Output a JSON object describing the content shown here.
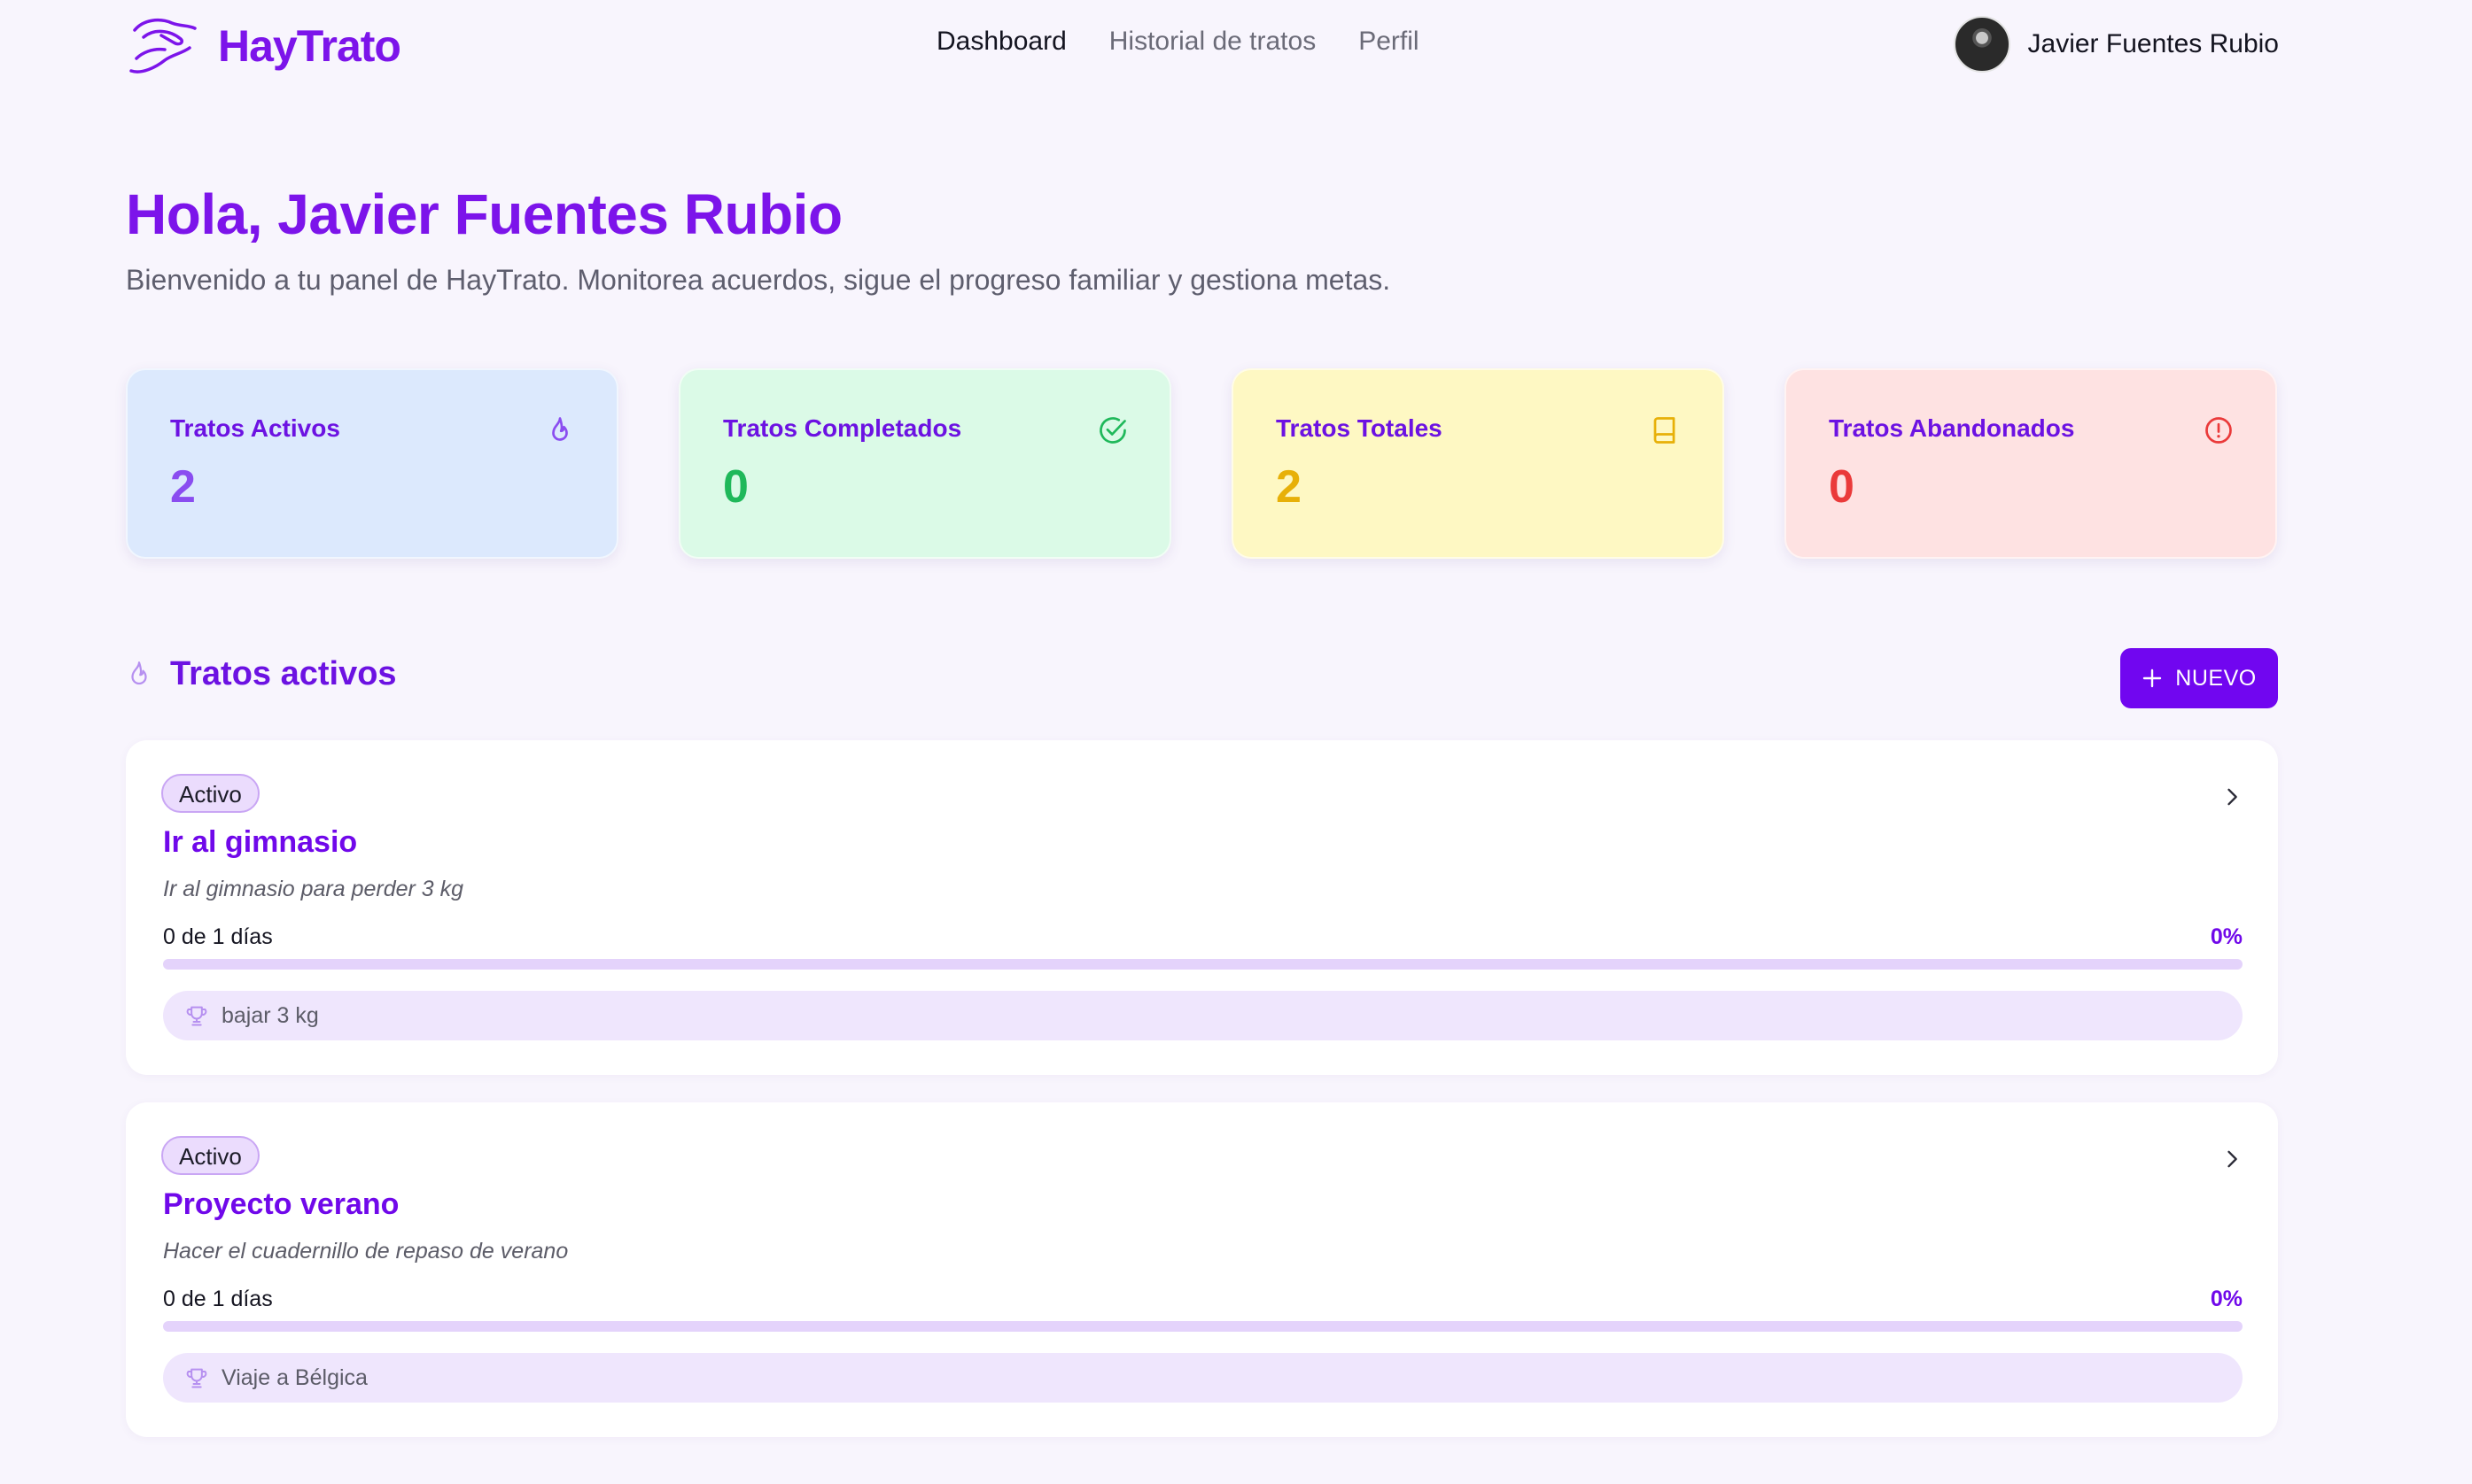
{
  "brand": {
    "name": "HayTrato",
    "accent": "#7106f0"
  },
  "nav": [
    {
      "label": "Dashboard",
      "active": true
    },
    {
      "label": "Historial de tratos",
      "active": false
    },
    {
      "label": "Perfil",
      "active": false
    }
  ],
  "user": {
    "name": "Javier Fuentes Rubio"
  },
  "greeting": {
    "title": "Hola, Javier Fuentes Rubio",
    "subtitle": "Bienvenido a tu panel de HayTrato. Monitorea acuerdos, sigue el progreso familiar y gestiona metas."
  },
  "stats": [
    {
      "label": "Tratos Activos",
      "value": "2",
      "icon": "flame-icon",
      "bg": "#dce9fd",
      "color": "#8a4df0"
    },
    {
      "label": "Tratos Completados",
      "value": "0",
      "icon": "check-circle-icon",
      "bg": "#dbfae7",
      "color": "#1fb85a"
    },
    {
      "label": "Tratos Totales",
      "value": "2",
      "icon": "book-icon",
      "bg": "#fef8c3",
      "color": "#e7b008"
    },
    {
      "label": "Tratos Abandonados",
      "value": "0",
      "icon": "alert-circle-icon",
      "bg": "#fee2e2",
      "color": "#ea3a3a"
    }
  ],
  "section": {
    "title": "Tratos activos",
    "new_button": "NUEVO"
  },
  "deals": [
    {
      "status": "Activo",
      "title": "Ir al gimnasio",
      "description": "Ir al gimnasio para perder 3 kg",
      "progress_text": "0 de 1 días",
      "percent_label": "0%",
      "progress": 0,
      "goal": "bajar 3 kg"
    },
    {
      "status": "Activo",
      "title": "Proyecto verano",
      "description": "Hacer el cuadernillo de repaso de verano",
      "progress_text": "0 de 1 días",
      "percent_label": "0%",
      "progress": 0,
      "goal": "Viaje a Bélgica"
    }
  ]
}
